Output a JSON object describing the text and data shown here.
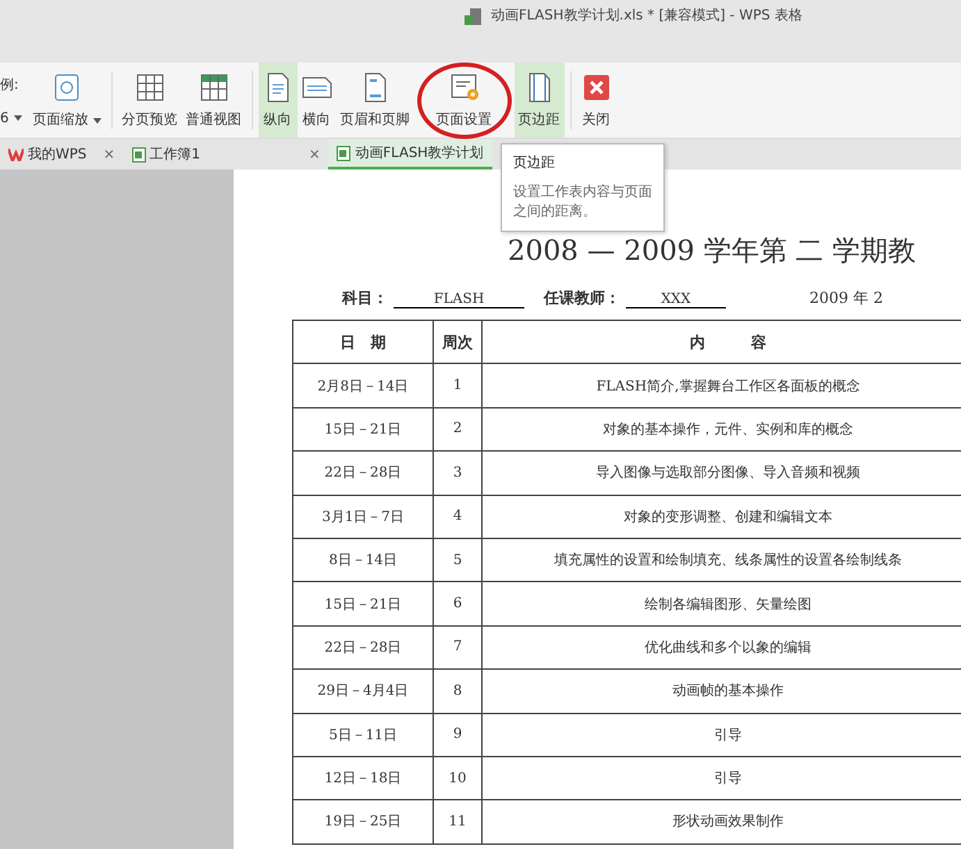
{
  "window": {
    "title": "动画FLASH教学计划.xls * [兼容模式] - WPS 表格"
  },
  "toolbar": {
    "scale_label": "例:",
    "scale_value": "6",
    "buttons": [
      {
        "label": "页面缩放",
        "dropdown": true,
        "selected": false
      },
      {
        "label": "分页预览",
        "dropdown": false,
        "selected": false
      },
      {
        "label": "普通视图",
        "dropdown": false,
        "selected": false
      },
      {
        "label": "纵向",
        "dropdown": false,
        "selected": true
      },
      {
        "label": "横向",
        "dropdown": false,
        "selected": false
      },
      {
        "label": "页眉和页脚",
        "dropdown": false,
        "selected": false
      },
      {
        "label": "页面设置",
        "dropdown": false,
        "selected": false,
        "circled": true
      },
      {
        "label": "页边距",
        "dropdown": false,
        "selected": true
      },
      {
        "label": "关闭",
        "dropdown": false,
        "selected": false
      }
    ]
  },
  "tabs": [
    {
      "label": "我的WPS",
      "selected": false,
      "close": "×"
    },
    {
      "label": "工作簿1",
      "selected": false,
      "close": "×"
    },
    {
      "label": "动画FLASH教学计划",
      "selected": true
    }
  ],
  "tooltip": {
    "title": "页边距",
    "text": "设置工作表内容与页面之间的距离。"
  },
  "sheet": {
    "title": "2008 — 2009 学年第 二 学期教",
    "subject_label": "科目：",
    "subject": "FLASH",
    "teacher_label": "任课教师：",
    "teacher": "XXX",
    "date": "2009 年 2",
    "columns": [
      "日　期",
      "周次",
      "内　　　容"
    ],
    "rows": [
      [
        "2月8日－14日",
        "1",
        "FLASH简介,掌握舞台工作区各面板的概念"
      ],
      [
        "15日－21日",
        "2",
        "对象的基本操作，元件、实例和库的概念"
      ],
      [
        "22日－28日",
        "3",
        "导入图像与选取部分图像、导入音频和视频"
      ],
      [
        "3月1日－7日",
        "4",
        "对象的变形调整、创建和编辑文本"
      ],
      [
        "8日－14日",
        "5",
        "填充属性的设置和绘制填充、线条属性的设置各绘制线条"
      ],
      [
        "15日－21日",
        "6",
        "绘制各编辑图形、矢量绘图"
      ],
      [
        "22日－28日",
        "7",
        "优化曲线和多个以象的编辑"
      ],
      [
        "29日－4月4日",
        "8",
        "动画帧的基本操作"
      ],
      [
        "5日－11日",
        "9",
        "引导"
      ],
      [
        "12日－18日",
        "10",
        "引导"
      ],
      [
        "19日－25日",
        "11",
        "形状动画效果制作"
      ]
    ]
  }
}
